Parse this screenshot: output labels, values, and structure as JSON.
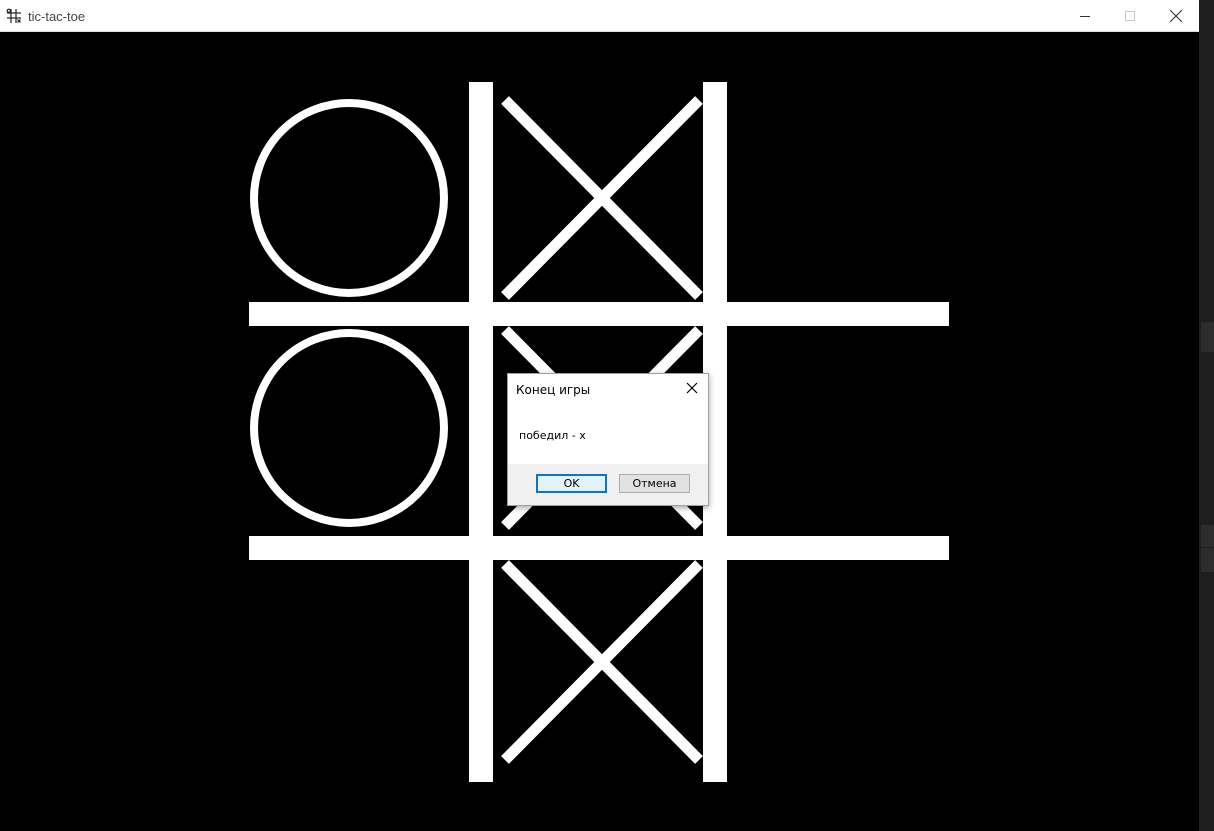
{
  "window": {
    "title": "tic-tac-toe",
    "app_icon": "grid-hash-icon",
    "controls": [
      "minimize-icon",
      "maximize-icon",
      "close-icon"
    ]
  },
  "board": {
    "cells": [
      [
        "O",
        "X",
        ""
      ],
      [
        "O",
        "X",
        ""
      ],
      [
        "",
        "X",
        ""
      ]
    ],
    "background_color": "#000000",
    "line_color": "#ffffff"
  },
  "dialog": {
    "title": "Конец игры",
    "message": "победил - x",
    "ok_label": "OK",
    "cancel_label": "Отмена",
    "close_icon": "close-icon",
    "accent_color": "#0078d7"
  }
}
